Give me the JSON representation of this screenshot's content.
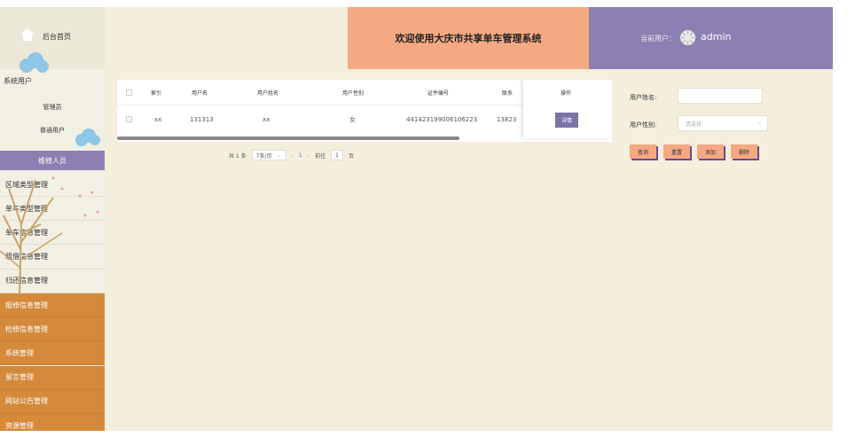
{
  "header": {
    "title": "欢迎使用大庆市共享单车管理系统",
    "user_label": "当前用户：",
    "user_name": "admin"
  },
  "sidebar": {
    "home_label": "后台首页",
    "system_users_label": "系统用户",
    "sub_items": [
      "管理员",
      "普通用户"
    ],
    "active_item": "维修人员",
    "items": [
      {
        "label": "区域类型管理",
        "dark": false
      },
      {
        "label": "单车类型管理",
        "dark": false
      },
      {
        "label": "单车信息管理",
        "dark": false
      },
      {
        "label": "租借信息管理",
        "dark": false
      },
      {
        "label": "归还信息管理",
        "dark": false
      },
      {
        "label": "报修信息管理",
        "dark": true
      },
      {
        "label": "检修信息管理",
        "dark": true
      },
      {
        "label": "系统管理",
        "dark": true
      },
      {
        "label": "留言管理",
        "dark": true
      },
      {
        "label": "网站公告管理",
        "dark": true
      },
      {
        "label": "资源管理",
        "dark": true
      }
    ]
  },
  "table": {
    "columns": [
      "索引",
      "用户名",
      "用户姓名",
      "用户性别",
      "证件编号",
      "联系",
      "操作"
    ],
    "rows": [
      {
        "index": "xx",
        "username": "131313",
        "name": "xx",
        "gender": "女",
        "id_number": "441423199006106223",
        "phone": "13823"
      }
    ],
    "action_label": "详情"
  },
  "pagination": {
    "total": "共 1 条",
    "page_size": "7条/页",
    "prev": "‹",
    "current_page": "1",
    "next": "›",
    "goto_prefix": "前往",
    "goto_value": "1",
    "goto_suffix": "页"
  },
  "search": {
    "name_label": "用户姓名:",
    "name_value": "",
    "gender_label": "用户性别:",
    "gender_placeholder": "请选择",
    "buttons": [
      "查询",
      "重置",
      "添加",
      "删除"
    ]
  },
  "colors": {
    "accent_purple": "#8c80b3",
    "peach": "#f5a983",
    "orange": "#d4893b",
    "background": "#f4eedd"
  }
}
